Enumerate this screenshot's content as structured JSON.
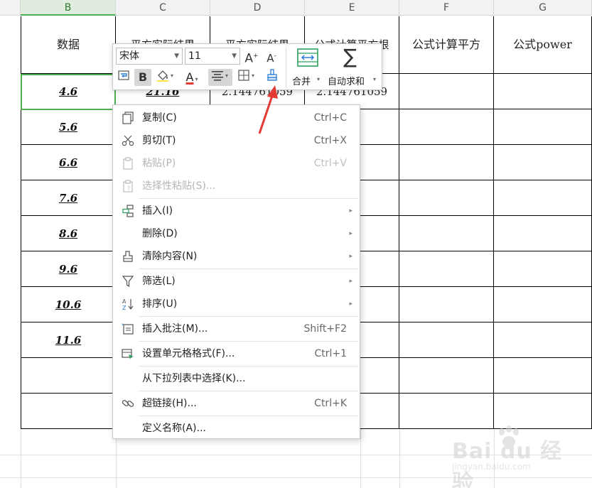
{
  "columns": [
    {
      "letter": "B",
      "active": true
    },
    {
      "letter": "C",
      "active": false
    },
    {
      "letter": "D",
      "active": false
    },
    {
      "letter": "E",
      "active": false
    },
    {
      "letter": "F",
      "active": false
    },
    {
      "letter": "G",
      "active": false
    }
  ],
  "header_row": {
    "b": "数据",
    "c": "平方实际结果",
    "d": "平方实际结果",
    "e": "公式计算平方根",
    "f": "公式计算平方",
    "g": "公式power"
  },
  "data_rows": [
    {
      "b": "4.6",
      "c": "21.16",
      "d": "2.144761059",
      "e": "2.144761059"
    },
    {
      "b": "5.6"
    },
    {
      "b": "6.6"
    },
    {
      "b": "7.6"
    },
    {
      "b": "8.6"
    },
    {
      "b": "9.6"
    },
    {
      "b": "10.6"
    },
    {
      "b": "11.6"
    }
  ],
  "mini_toolbar": {
    "font_name": "宋体",
    "font_size": "11",
    "grow_font": "A",
    "shrink_font": "A",
    "bold": "B",
    "font_color_glyph": "A",
    "merge_label": "合并",
    "autosum_label": "自动求和",
    "autosum_glyph": "∑"
  },
  "context_menu": {
    "items": [
      {
        "label": "复制(C)",
        "shortcut": "Ctrl+C",
        "disabled": false,
        "submenu": false,
        "icon": "copy-icon"
      },
      {
        "label": "剪切(T)",
        "shortcut": "Ctrl+X",
        "disabled": false,
        "submenu": false,
        "icon": "scissors-icon"
      },
      {
        "label": "粘贴(P)",
        "shortcut": "Ctrl+V",
        "disabled": true,
        "submenu": false,
        "icon": "paste-icon"
      },
      {
        "label": "选择性粘贴(S)...",
        "shortcut": "",
        "disabled": true,
        "submenu": false,
        "icon": "paste-special-icon"
      },
      {
        "label": "插入(I)",
        "shortcut": "",
        "disabled": false,
        "submenu": true,
        "icon": "insert-icon"
      },
      {
        "label": "删除(D)",
        "shortcut": "",
        "disabled": false,
        "submenu": true,
        "icon": ""
      },
      {
        "label": "清除内容(N)",
        "shortcut": "",
        "disabled": false,
        "submenu": true,
        "icon": "eraser-icon"
      },
      {
        "label": "筛选(L)",
        "shortcut": "",
        "disabled": false,
        "submenu": true,
        "icon": "filter-icon"
      },
      {
        "label": "排序(U)",
        "shortcut": "",
        "disabled": false,
        "submenu": true,
        "icon": "sort-icon"
      },
      {
        "label": "插入批注(M)...",
        "shortcut": "Shift+F2",
        "disabled": false,
        "submenu": false,
        "icon": "comment-icon"
      },
      {
        "label": "设置单元格格式(F)...",
        "shortcut": "Ctrl+1",
        "disabled": false,
        "submenu": false,
        "icon": "format-cells-icon"
      },
      {
        "label": "从下拉列表中选择(K)...",
        "shortcut": "",
        "disabled": false,
        "submenu": false,
        "icon": ""
      },
      {
        "label": "超链接(H)...",
        "shortcut": "Ctrl+K",
        "disabled": false,
        "submenu": false,
        "icon": "link-icon"
      },
      {
        "label": "定义名称(A)...",
        "shortcut": "",
        "disabled": false,
        "submenu": false,
        "icon": ""
      }
    ]
  },
  "watermark": {
    "brand": "Bai du 经验",
    "url": "jingyan.baidu.com"
  },
  "colors": {
    "selection_green": "#4caf50",
    "annotation_red": "#e53935",
    "format_painter_blue": "#2b7bd6",
    "merge_green": "#2e9e5e"
  }
}
